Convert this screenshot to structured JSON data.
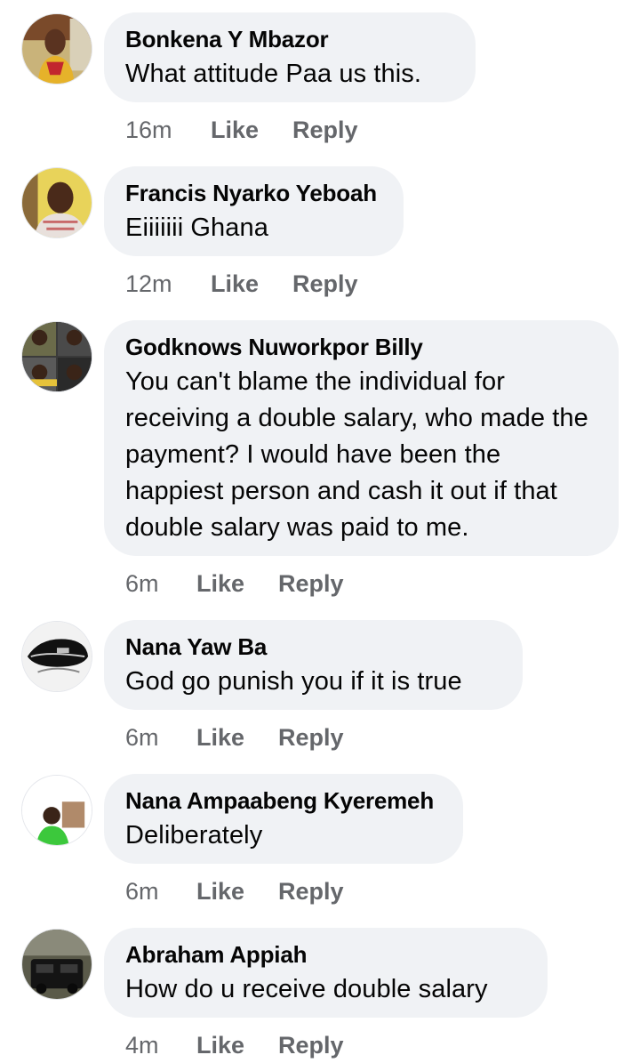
{
  "comments": [
    {
      "author": "Bonkena Y Mbazor",
      "text": "What attitude Paa us this.",
      "time": "16m",
      "like": "Like",
      "reply": "Reply"
    },
    {
      "author": "Francis Nyarko Yeboah",
      "text": "Eiiiiiii Ghana",
      "time": "12m",
      "like": "Like",
      "reply": "Reply"
    },
    {
      "author": "Godknows Nuworkpor Billy",
      "text": "You can't blame the individual for receiving a double salary, who made the payment? I would have been the happiest person and cash it out if that double salary was paid to me.",
      "time": "6m",
      "like": "Like",
      "reply": "Reply"
    },
    {
      "author": "Nana Yaw Ba",
      "text": "God go punish you if it is true",
      "time": "6m",
      "like": "Like",
      "reply": "Reply"
    },
    {
      "author": "Nana Ampaabeng Kyeremeh",
      "text": "Deliberately",
      "time": "6m",
      "like": "Like",
      "reply": "Reply"
    },
    {
      "author": "Abraham Appiah",
      "text": "How do u receive double salary",
      "time": "4m",
      "like": "Like",
      "reply": "Reply"
    }
  ],
  "colors": {
    "bubble": "#f0f2f5",
    "name": "#050505",
    "meta": "#65676b"
  }
}
